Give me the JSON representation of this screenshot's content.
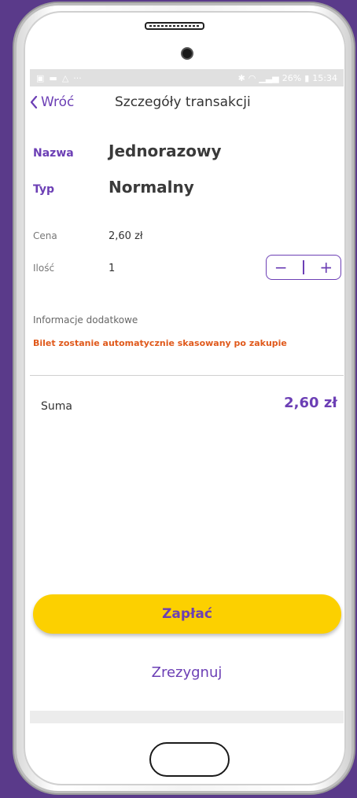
{
  "status_bar": {
    "left_icons": [
      "image-icon",
      "chat-icon",
      "notification-icon",
      "more-icon"
    ],
    "bluetooth": "✱",
    "battery": "26%",
    "time": "15:34"
  },
  "header": {
    "back_label": "Wróć",
    "title": "Szczegóły transakcji"
  },
  "ticket": {
    "name_label": "Nazwa",
    "name_value": "Jednorazowy",
    "type_label": "Typ",
    "type_value": "Normalny"
  },
  "details": {
    "price_label": "Cena",
    "price_value": "2,60 zł",
    "quantity_label": "Ilość",
    "quantity_value": "1",
    "minus": "−",
    "plus": "+"
  },
  "info": {
    "title": "Informacje dodatkowe",
    "text": "Bilet zostanie automatycznie skasowany po zakupie"
  },
  "summary": {
    "label": "Suma",
    "value": "2,60 zł"
  },
  "actions": {
    "pay_label": "Zapłać",
    "cancel_label": "Zrezygnuj"
  },
  "colors": {
    "accent": "#6c3fb5",
    "pay_button": "#fcd000",
    "warning_text": "#e0591b",
    "background": "#5a3a8a"
  }
}
